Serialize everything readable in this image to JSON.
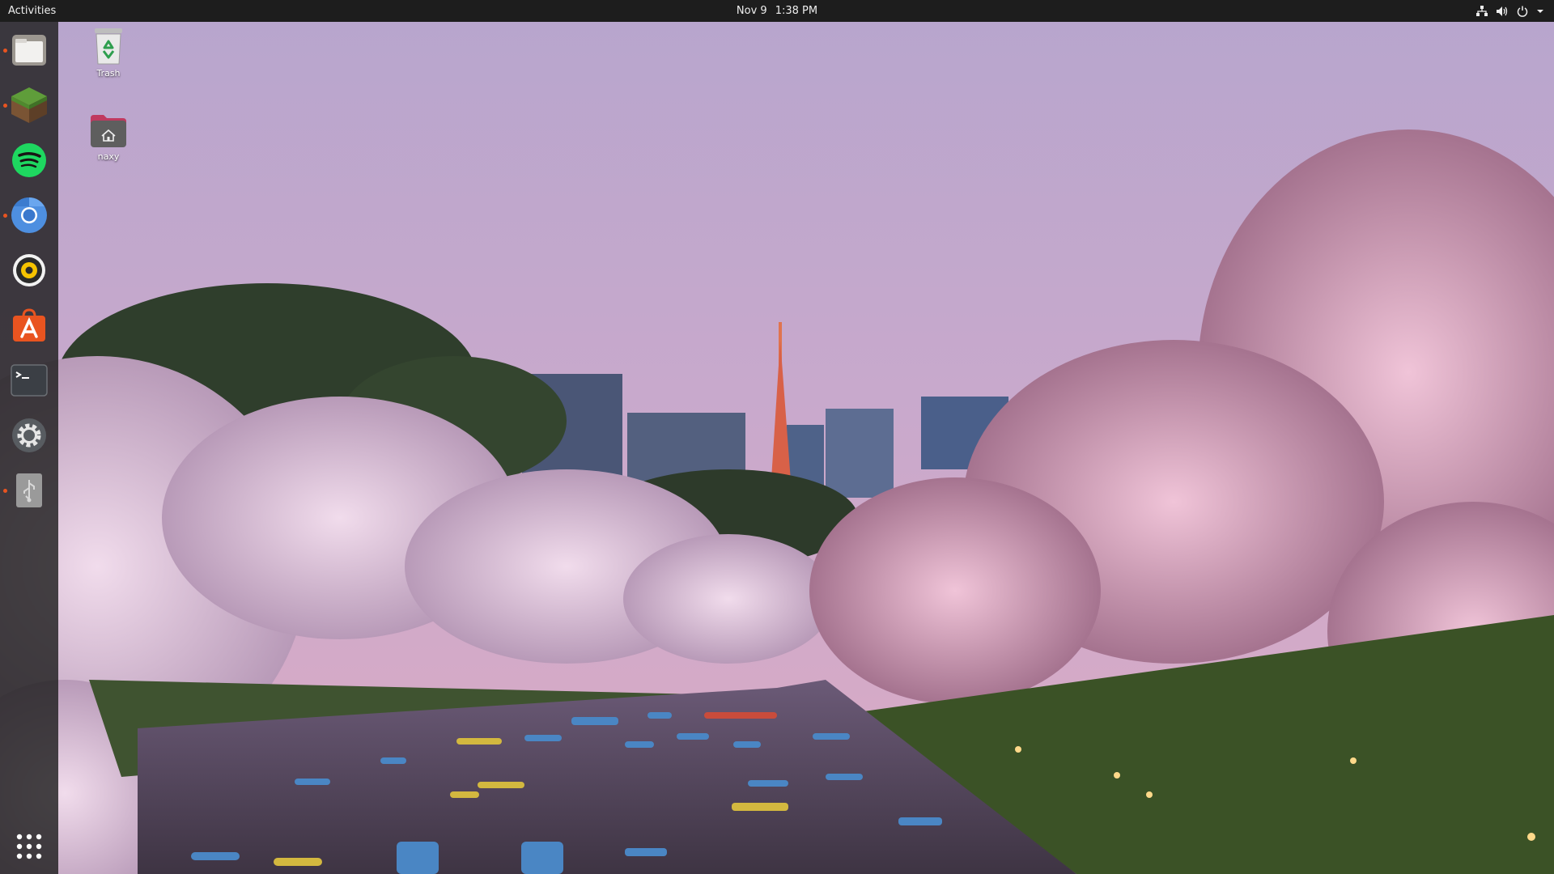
{
  "topbar": {
    "activities_label": "Activities",
    "date": "Nov 9",
    "time": "1:38 PM",
    "indicators": [
      "network-icon",
      "volume-icon",
      "power-icon",
      "menu-arrow-icon"
    ]
  },
  "dock": {
    "items": [
      {
        "name": "files",
        "icon": "files-icon",
        "running": true
      },
      {
        "name": "minecraft",
        "icon": "minecraft-grass-block-icon",
        "running": true
      },
      {
        "name": "spotify",
        "icon": "spotify-icon",
        "running": false
      },
      {
        "name": "chromium",
        "icon": "chromium-icon",
        "running": true
      },
      {
        "name": "rhythmbox",
        "icon": "rhythmbox-icon",
        "running": false
      },
      {
        "name": "ubuntu-software",
        "icon": "ubuntu-software-icon",
        "running": false
      },
      {
        "name": "terminal",
        "icon": "terminal-icon",
        "running": false
      },
      {
        "name": "settings",
        "icon": "settings-gear-icon",
        "running": false
      },
      {
        "name": "usb-drive",
        "icon": "usb-drive-icon",
        "running": true
      }
    ],
    "show_apps_icon": "app-grid-icon"
  },
  "desktop": {
    "icons": [
      {
        "label": "Trash",
        "icon": "trash-icon"
      },
      {
        "label": "naxy",
        "icon": "home-folder-icon"
      }
    ]
  },
  "colors": {
    "topbar_bg": "#1d1d1d",
    "dock_bg": "#1e1e1e",
    "accent_orange": "#e95420",
    "spotify_green": "#1ed760",
    "sky_top": "#b7a5cd",
    "sky_bottom": "#d8a9c3",
    "blossom": "#e6bfd6"
  }
}
